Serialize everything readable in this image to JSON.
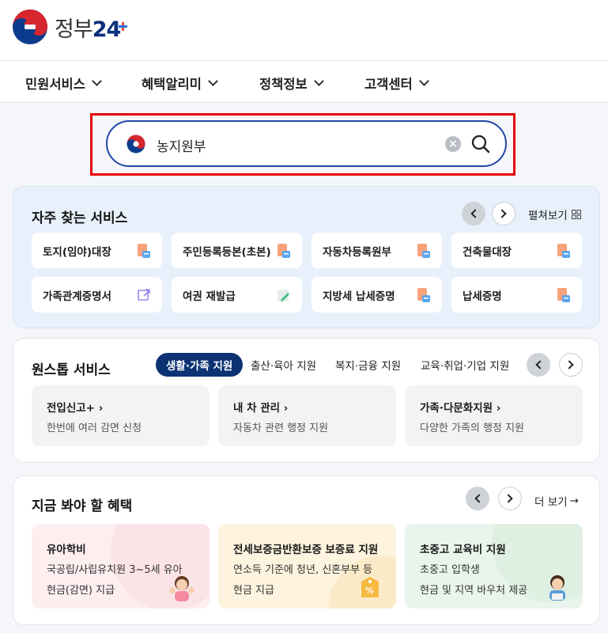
{
  "logo": {
    "text_a": "정부",
    "text_b": "2",
    "text_c": "4"
  },
  "nav": [
    {
      "label": "민원서비스"
    },
    {
      "label": "혜택알리미"
    },
    {
      "label": "정책정보"
    },
    {
      "label": "고객센터"
    }
  ],
  "search": {
    "value": "농지원부",
    "clear_icon": "×"
  },
  "frequent": {
    "title": "자주 찾는 서비스",
    "view_all": "펼쳐보기",
    "items": [
      {
        "label": "토지(임야)대장",
        "icon": "document-icon"
      },
      {
        "label": "주민등록등본(초본)",
        "icon": "document-icon"
      },
      {
        "label": "자동차등록원부",
        "icon": "document-icon"
      },
      {
        "label": "건축물대장",
        "icon": "document-icon"
      },
      {
        "label": "가족관계증명서",
        "icon": "external-link-icon"
      },
      {
        "label": "여권 재발급",
        "icon": "pencil-icon"
      },
      {
        "label": "지방세 납세증명",
        "icon": "document-icon"
      },
      {
        "label": "납세증명",
        "icon": "document-icon"
      }
    ]
  },
  "onestop": {
    "title": "원스톱 서비스",
    "tabs": [
      {
        "label": "생활·가족 지원",
        "active": true
      },
      {
        "label": "출산·육아 지원"
      },
      {
        "label": "복지·금융 지원"
      },
      {
        "label": "교육·취업·기업 지원"
      }
    ],
    "items": [
      {
        "title": "전입신고+",
        "desc": "한번에 여러 감면 신청"
      },
      {
        "title": "내 차 관리",
        "desc": "자동차 관련 행정 지원"
      },
      {
        "title": "가족·다문화지원",
        "desc": "다양한 가족의 행정 지원"
      }
    ]
  },
  "benefits": {
    "title": "지금 봐야 할 혜택",
    "more": "더 보기",
    "items": [
      {
        "title": "유아학비",
        "line1": "국공립/사립유치원 3~5세 유아",
        "line2": "현금(감면) 지급",
        "color": "#fdeef0"
      },
      {
        "title": "전세보증금반환보증 보증료 지원",
        "line1": "연소득 기준에 청년, 신혼부부 등",
        "line2": "현금 지급",
        "color": "#fdf3de"
      },
      {
        "title": "초중고 교육비 지원",
        "line1": "초중고 입학생",
        "line2": "현금 및 지역 바우처 제공",
        "color": "#e9f5ec"
      }
    ]
  }
}
